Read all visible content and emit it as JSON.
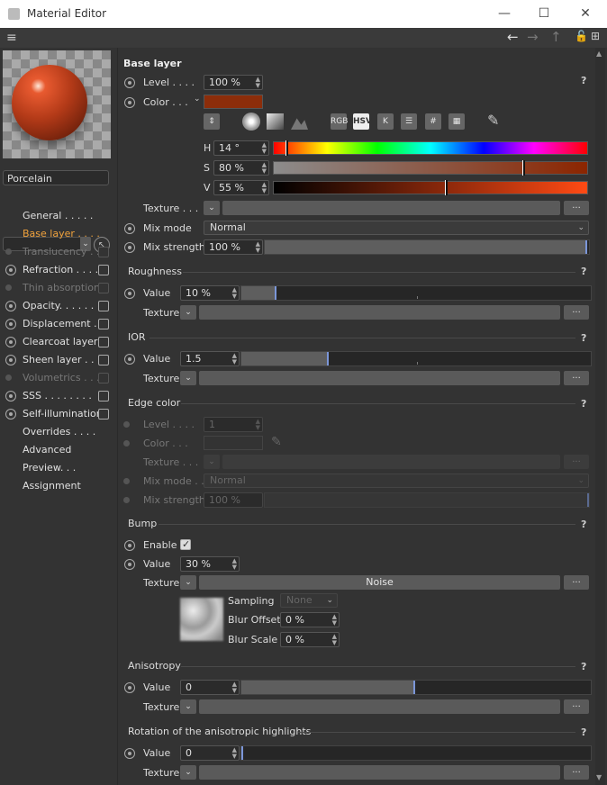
{
  "window": {
    "title": "Material Editor"
  },
  "sidebar": {
    "material_name": "Porcelain",
    "items": [
      {
        "label": "General",
        "dots": " . . . . .",
        "state": "none"
      },
      {
        "label": "Base layer",
        "dots": " . . . .",
        "state": "active"
      },
      {
        "label": "Translucency",
        "dots": " . .",
        "state": "dim"
      },
      {
        "label": "Refraction",
        "dots": " . . . .",
        "state": "on"
      },
      {
        "label": "Thin absorption",
        "dots": "",
        "state": "dim"
      },
      {
        "label": "Opacity",
        "dots": ". . . . . .",
        "state": "on"
      },
      {
        "label": "Displacement",
        "dots": " . .",
        "state": "on"
      },
      {
        "label": "Clearcoat layer",
        "dots": "",
        "state": "on"
      },
      {
        "label": "Sheen layer",
        "dots": " . . . .",
        "state": "on"
      },
      {
        "label": "Volumetrics",
        "dots": " . . .",
        "state": "dim"
      },
      {
        "label": "SSS",
        "dots": " . . . . . . . .",
        "state": "on"
      },
      {
        "label": "Self-illumination",
        "dots": "",
        "state": "on"
      },
      {
        "label": "Overrides",
        "dots": " . . . .",
        "state": "none"
      },
      {
        "label": "Advanced",
        "dots": "",
        "state": "none"
      },
      {
        "label": "Preview",
        "dots": ". . .",
        "state": "none"
      },
      {
        "label": "Assignment",
        "dots": "",
        "state": "none"
      }
    ]
  },
  "base_layer": {
    "title": "Base layer",
    "level_label": "Level",
    "level_dots": " . . . .",
    "level_value": "100 %",
    "color_label": "Color",
    "color_dots": " . . .",
    "color_hex": "#8c2d0a",
    "color_modes": [
      "RGB",
      "HSV",
      "K",
      "#"
    ],
    "h_label": "H",
    "h_value": "14 °",
    "h_fraction": 0.039,
    "s_label": "S",
    "s_value": "80 %",
    "s_fraction": 0.8,
    "v_label": "V",
    "v_value": "55 %",
    "v_fraction": 0.55,
    "texture_label": "Texture",
    "texture_dots": " . . .",
    "mixmode_label": "Mix mode",
    "mixmode_value": "Normal",
    "mixstrength_label": "Mix strength",
    "mixstrength_value": "100 %",
    "mixstrength_fraction": 1.0
  },
  "roughness": {
    "title": "Roughness",
    "value_label": "Value",
    "value": "10 %",
    "fraction": 0.1,
    "texture_label": "Texture"
  },
  "ior": {
    "title": "IOR",
    "value_label": "Value",
    "value": "1.5",
    "fraction": 0.25,
    "texture_label": "Texture"
  },
  "edge_color": {
    "title": "Edge color",
    "level_label": "Level",
    "level_dots": " . . . .",
    "level_value": "1",
    "color_label": "Color",
    "color_dots": " . . .",
    "texture_label": "Texture",
    "texture_dots": " . . .",
    "mixmode_label": "Mix mode",
    "mixmode_dots": " . .",
    "mixmode_value": "Normal",
    "mixstrength_label": "Mix strength",
    "mixstrength_value": "100 %"
  },
  "bump": {
    "title": "Bump",
    "enable_label": "Enable",
    "value_label": "Value",
    "value": "30 %",
    "texture_label": "Texture",
    "texture_name": "Noise",
    "sampling_label": "Sampling",
    "sampling_value": "None",
    "blur_offset_label": "Blur Offset",
    "blur_offset_value": "0 %",
    "blur_scale_label": "Blur Scale",
    "blur_scale_value": "0 %"
  },
  "anisotropy": {
    "title": "Anisotropy",
    "value_label": "Value",
    "value": "0",
    "fraction": 0.5,
    "texture_label": "Texture"
  },
  "rotation": {
    "title": "Rotation of the anisotropic highlights",
    "value_label": "Value",
    "value": "0",
    "fraction": 0.0,
    "texture_label": "Texture"
  },
  "common": {
    "help": "?",
    "more": "...",
    "dropdown_arrow": "⌄"
  }
}
